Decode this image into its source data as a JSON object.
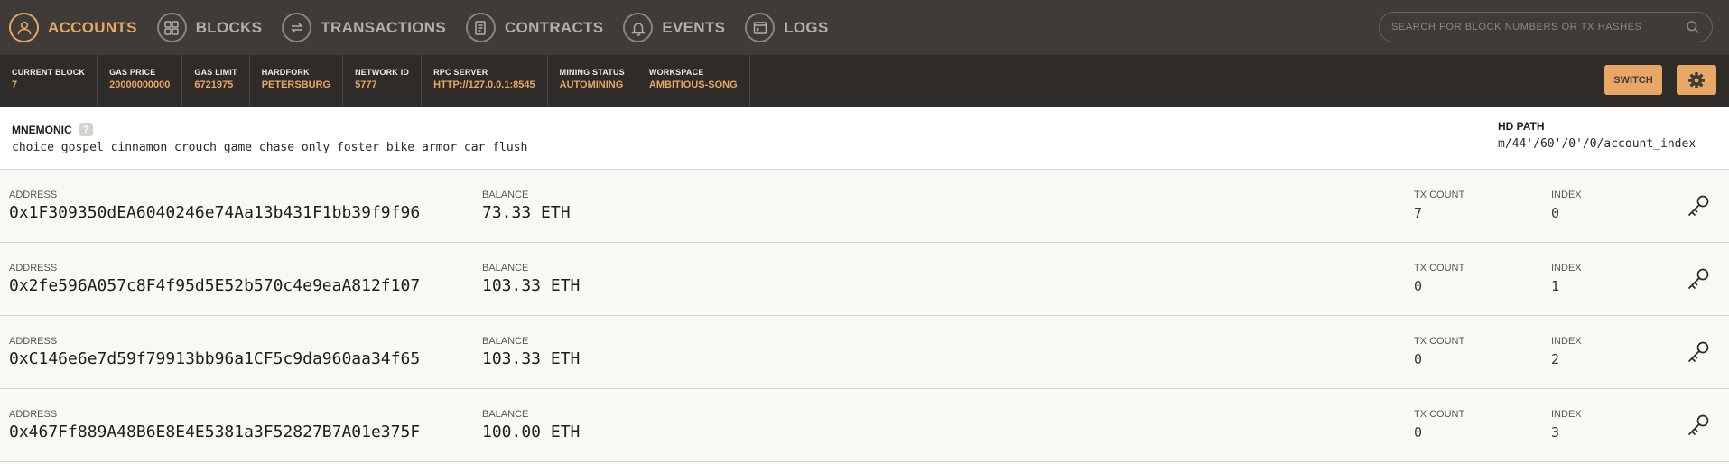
{
  "nav": {
    "items": [
      {
        "label": "ACCOUNTS",
        "icon": "person-icon",
        "active": true
      },
      {
        "label": "BLOCKS",
        "icon": "blocks-icon",
        "active": false
      },
      {
        "label": "TRANSACTIONS",
        "icon": "transactions-icon",
        "active": false
      },
      {
        "label": "CONTRACTS",
        "icon": "contracts-icon",
        "active": false
      },
      {
        "label": "EVENTS",
        "icon": "bell-icon",
        "active": false
      },
      {
        "label": "LOGS",
        "icon": "logs-icon",
        "active": false
      }
    ],
    "search_placeholder": "SEARCH FOR BLOCK NUMBERS OR TX HASHES"
  },
  "status": {
    "current_block": {
      "label": "CURRENT BLOCK",
      "value": "7"
    },
    "gas_price": {
      "label": "GAS PRICE",
      "value": "20000000000"
    },
    "gas_limit": {
      "label": "GAS LIMIT",
      "value": "6721975"
    },
    "hardfork": {
      "label": "HARDFORK",
      "value": "PETERSBURG"
    },
    "network_id": {
      "label": "NETWORK ID",
      "value": "5777"
    },
    "rpc_server": {
      "label": "RPC SERVER",
      "value": "HTTP://127.0.0.1:8545"
    },
    "mining_status": {
      "label": "MINING STATUS",
      "value": "AUTOMINING"
    },
    "workspace": {
      "label": "WORKSPACE",
      "value": "AMBITIOUS-SONG"
    },
    "switch_label": "SWITCH"
  },
  "mnemonic": {
    "label": "MNEMONIC",
    "help": "?",
    "value": "choice gospel cinnamon crouch game chase only foster bike armor car flush",
    "hd_path_label": "HD PATH",
    "hd_path_value": "m/44'/60'/0'/0/account_index"
  },
  "account_labels": {
    "address": "ADDRESS",
    "balance": "BALANCE",
    "tx_count": "TX COUNT",
    "index": "INDEX"
  },
  "accounts": [
    {
      "address": "0x1F309350dEA6040246e74Aa13b431F1bb39f9f96",
      "balance": "73.33 ETH",
      "tx_count": "7",
      "index": "0"
    },
    {
      "address": "0x2fe596A057c8F4f95d5E52b570c4e9eaA812f107",
      "balance": "103.33 ETH",
      "tx_count": "0",
      "index": "1"
    },
    {
      "address": "0xC146e6e7d59f79913bb96a1CF5c9da960aa34f65",
      "balance": "103.33 ETH",
      "tx_count": "0",
      "index": "2"
    },
    {
      "address": "0x467Ff889A48B6E8E4E5381a3F52827B7A01e375F",
      "balance": "100.00 ETH",
      "tx_count": "0",
      "index": "3"
    }
  ],
  "colors": {
    "accent": "#e8a764",
    "nav_bg": "#3f3b37",
    "status_bg": "#2f2b28"
  }
}
